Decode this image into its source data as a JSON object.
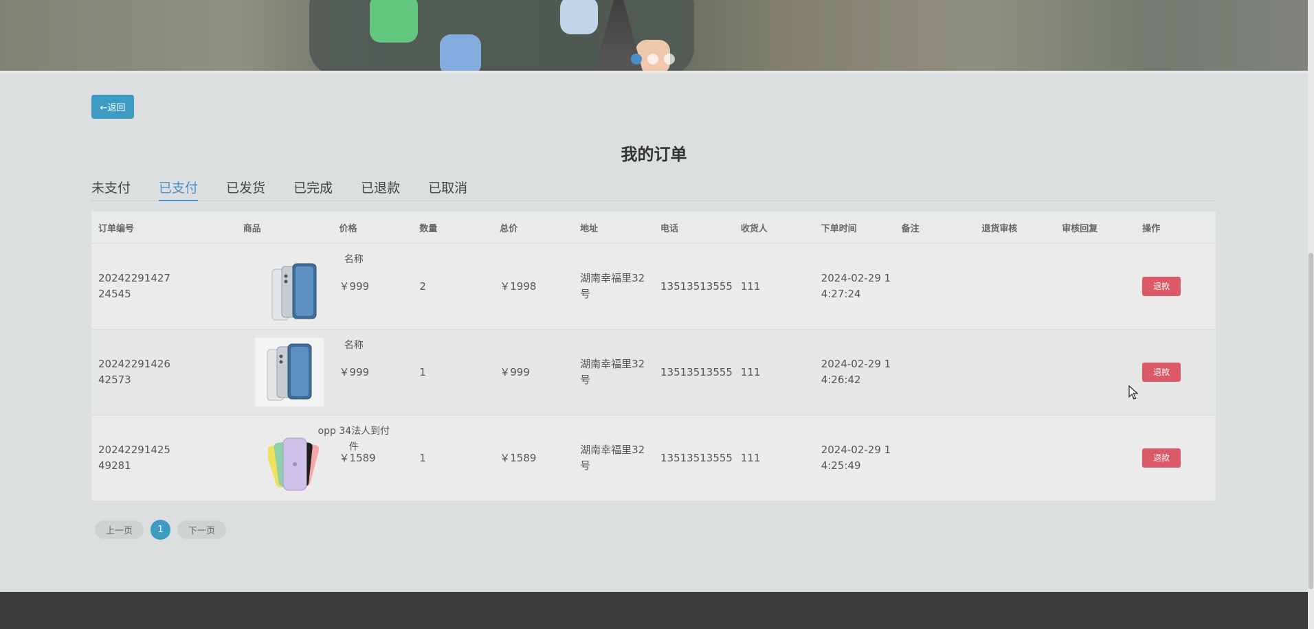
{
  "back_button": {
    "label": "←返回"
  },
  "page_title": "我的订单",
  "tabs": [
    {
      "label": "未支付"
    },
    {
      "label": "已支付"
    },
    {
      "label": "已发货"
    },
    {
      "label": "已完成"
    },
    {
      "label": "已退款"
    },
    {
      "label": "已取消"
    }
  ],
  "active_tab": "已支付",
  "table": {
    "headers": [
      "订单编号",
      "商品",
      "价格",
      "数量",
      "总价",
      "地址",
      "电话",
      "收货人",
      "下单时间",
      "备注",
      "退货审核",
      "审核回复",
      "操作"
    ],
    "rows": [
      {
        "order_no": "2024229142724545",
        "goods_name": "名称",
        "goods_image": "phone-blue-white",
        "price": "￥999",
        "qty": "2",
        "total": "￥1998",
        "address": "湖南幸福里32号",
        "phone": "13513513555",
        "receiver": "111",
        "time": "2024-02-29 14:27:24",
        "note": "",
        "audit": "",
        "reply": "",
        "action": "退款"
      },
      {
        "order_no": "2024229142642573",
        "goods_name": "名称",
        "goods_image": "phone-blue-white",
        "price": "￥999",
        "qty": "1",
        "total": "￥999",
        "address": "湖南幸福里32号",
        "phone": "13513513555",
        "receiver": "111",
        "time": "2024-02-29 14:26:42",
        "note": "",
        "audit": "",
        "reply": "",
        "action": "退款"
      },
      {
        "order_no": "2024229142549281",
        "goods_name": "opp 34法人到付件",
        "goods_image": "phone-purple-fan",
        "price": "￥1589",
        "qty": "1",
        "total": "￥1589",
        "address": "湖南幸福里32号",
        "phone": "13513513555",
        "receiver": "111",
        "time": "2024-02-29 14:25:49",
        "note": "",
        "audit": "",
        "reply": "",
        "action": "退款"
      }
    ]
  },
  "pagination": {
    "prev": "上一页",
    "current": "1",
    "next": "下一页"
  },
  "colors": {
    "primary": "#3e9bc1",
    "tab_active": "#4a8fd0",
    "danger": "#dc5a67",
    "footer": "#3b3b3b"
  }
}
